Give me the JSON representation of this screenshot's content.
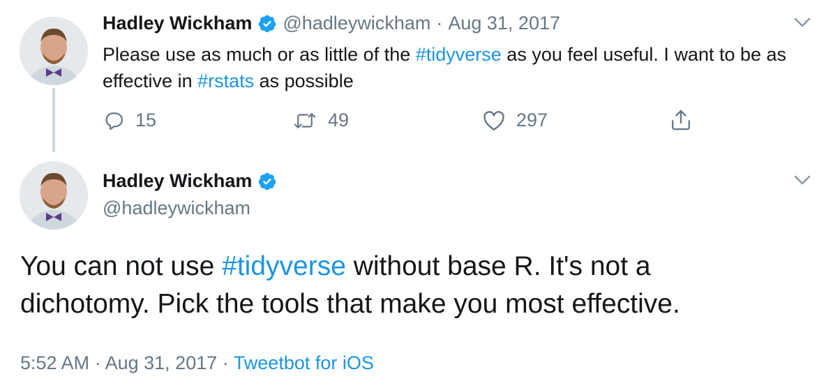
{
  "reply_tweet": {
    "author_name": "Hadley Wickham",
    "author_handle": "@hadleywickham",
    "separator": "·",
    "date": "Aug 31, 2017",
    "text_part1": "Please use as much or as little of the ",
    "hashtag1": "#tidyverse",
    "text_part2": " as you feel useful. I want to be as effective in ",
    "hashtag2": "#rstats",
    "text_part3": " as possible",
    "reply_count": "15",
    "retweet_count": "49",
    "like_count": "297"
  },
  "main_tweet": {
    "author_name": "Hadley Wickham",
    "author_handle": "@hadleywickham",
    "text_part1": "You can not use ",
    "hashtag": "#tidyverse",
    "text_part2": " without base R. It's not a dichotomy. Pick the tools that make you most effective.",
    "time": "5:52 AM",
    "separator1": "·",
    "date": "Aug 31, 2017",
    "separator2": "·",
    "source": "Tweetbot for iOS"
  },
  "colors": {
    "hashtag": "#1b95e0",
    "verified": "#1da1f2",
    "muted": "#657786",
    "thread_line": "#ccd6dd"
  },
  "icons": [
    "verified-badge-icon",
    "reply-icon",
    "retweet-icon",
    "like-icon",
    "share-icon",
    "chevron-down-icon"
  ]
}
